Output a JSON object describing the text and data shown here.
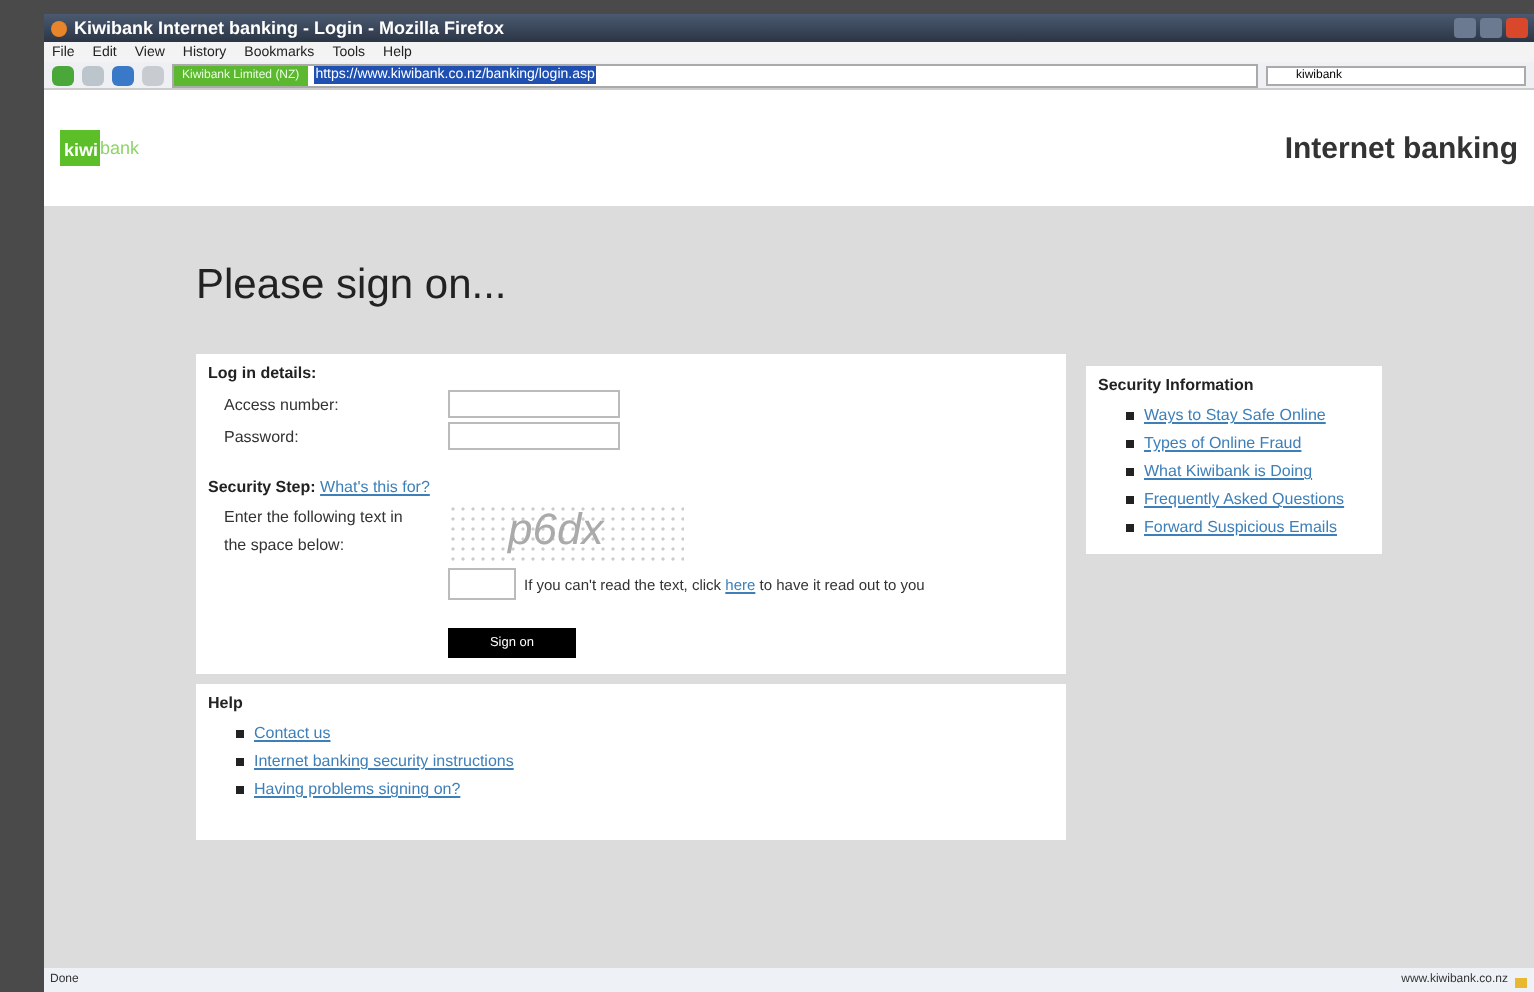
{
  "window": {
    "title": "Kiwibank Internet banking - Login - Mozilla Firefox"
  },
  "menu": [
    "File",
    "Edit",
    "View",
    "History",
    "Bookmarks",
    "Tools",
    "Help"
  ],
  "toolbar": {
    "identity": "Kiwibank Limited (NZ)",
    "url": "https://www.kiwibank.co.nz/banking/login.asp",
    "search": "kiwibank"
  },
  "header": {
    "logo_a": "kiwi",
    "logo_b": "bank",
    "title": "Internet banking"
  },
  "heading": "Please sign on...",
  "login": {
    "title": "Log in details:",
    "fields": [
      {
        "label": "Access number:"
      },
      {
        "label": "Password:"
      }
    ],
    "security_label": "Security Step:",
    "security_link": "What's this for?",
    "instruction": "Enter the following text in the space below:",
    "captcha": "p6dx",
    "hint_before": "If you can't read the text, click",
    "hint_link": "here",
    "hint_after": "to have it read out to you",
    "button": "Sign on"
  },
  "help": {
    "title": "Help",
    "links": [
      "Contact us",
      "Internet banking security instructions",
      "Having problems signing on?"
    ]
  },
  "security_info": {
    "title": "Security Information",
    "links": [
      "Ways to Stay Safe Online",
      "Types of Online Fraud",
      "What Kiwibank is Doing",
      "Frequently Asked Questions",
      "Forward Suspicious Emails"
    ]
  },
  "status_bar": {
    "left": "Done",
    "right": "www.kiwibank.co.nz"
  }
}
